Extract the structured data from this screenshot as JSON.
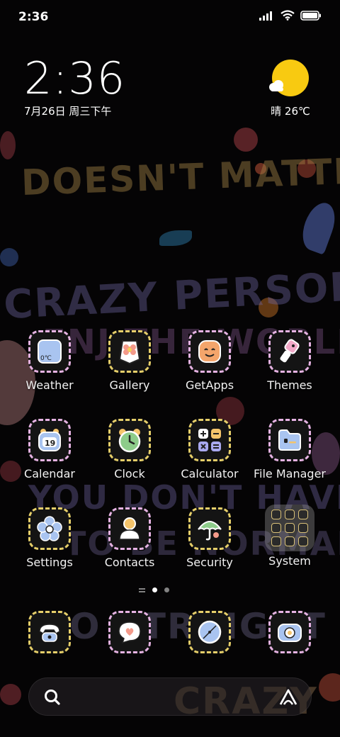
{
  "status_bar": {
    "time": "2:36",
    "signal_icon": "signal-bars-icon",
    "wifi_icon": "wifi-icon",
    "battery_icon": "battery-icon"
  },
  "clock_widget": {
    "time": "2:36",
    "date": "7月26日 周三下午"
  },
  "weather_widget": {
    "icon": "sun-cloud-icon",
    "text": "晴 26℃"
  },
  "wallpaper": {
    "lines": [
      "DOESN'T MATTER",
      "CRAZY PERSON",
      "ENJ  THE WORLD",
      "YOU DON'T HAVE",
      "TO BE NORMAL",
      "SO STRAIGHT",
      "CRAZY"
    ]
  },
  "apps": [
    {
      "label": "Weather",
      "icon": "weather-icon"
    },
    {
      "label": "Gallery",
      "icon": "gallery-flower-icon"
    },
    {
      "label": "GetApps",
      "icon": "getapps-icon"
    },
    {
      "label": "Themes",
      "icon": "themes-brush-icon"
    },
    {
      "label": "Calendar",
      "icon": "calendar-icon",
      "badge": "19"
    },
    {
      "label": "Clock",
      "icon": "alarm-clock-icon"
    },
    {
      "label": "Calculator",
      "icon": "calculator-icon"
    },
    {
      "label": "File Manager",
      "icon": "folder-icon"
    },
    {
      "label": "Settings",
      "icon": "settings-flower-icon"
    },
    {
      "label": "Contacts",
      "icon": "contacts-person-icon"
    },
    {
      "label": "Security",
      "icon": "security-umbrella-icon"
    },
    {
      "label": "System",
      "icon": "system-folder-icon"
    }
  ],
  "weather_app_badge": "0℃",
  "dock": [
    {
      "icon": "phone-icon"
    },
    {
      "icon": "messages-icon"
    },
    {
      "icon": "browser-icon"
    },
    {
      "icon": "camera-icon"
    }
  ],
  "search_bar": {
    "search_icon": "search-icon",
    "assistant_icon": "assistant-icon"
  },
  "page_indicator": {
    "pages": 2,
    "active": 1
  },
  "colors": {
    "icon_border_yellow": "#e6cf6a",
    "icon_border_pink": "#e6b3e3",
    "sun": "#f8ca11"
  }
}
